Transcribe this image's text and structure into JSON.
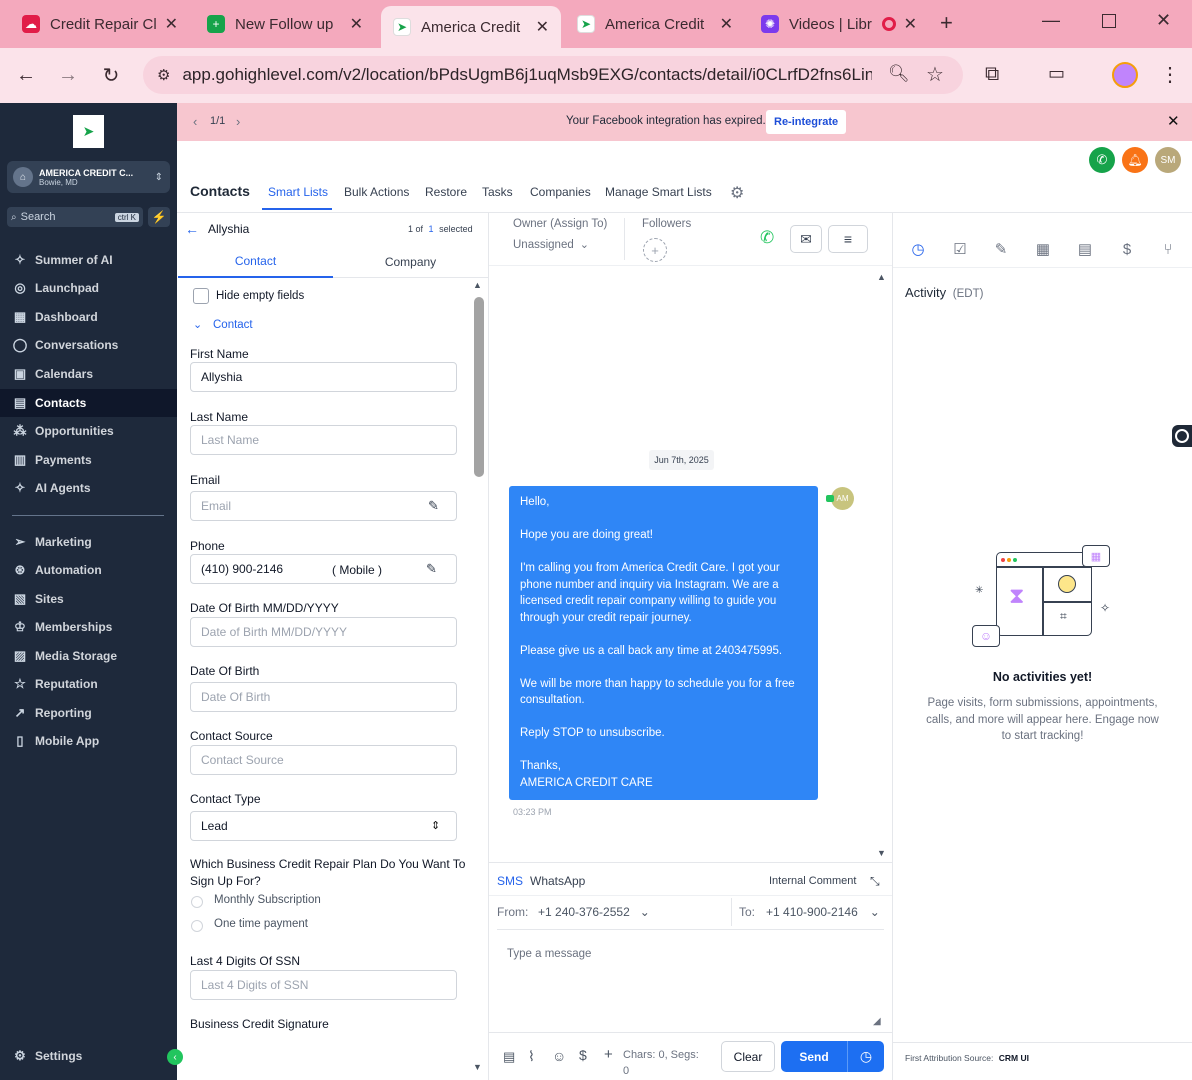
{
  "browser": {
    "tabs": [
      {
        "title": "Credit Repair Cl",
        "favicon_color": "#e11d48"
      },
      {
        "title": "New Follow up",
        "favicon_color": "#16a34a"
      },
      {
        "title": "America Credit",
        "favicon_color": "#ffffff"
      },
      {
        "title": "America Credit",
        "favicon_color": "#ffffff"
      },
      {
        "title": "Videos | Libr",
        "favicon_color": "#7c3aed"
      }
    ],
    "url": "app.gohighlevel.com/v2/location/bPdsUgmB6j1uqMsb9EXG/contacts/detail/i0CLrfD2fns6Lin..."
  },
  "sidebar": {
    "account_name": "AMERICA CREDIT C...",
    "account_location": "Bowie, MD",
    "search_placeholder": "Search",
    "search_shortcut": "ctrl K",
    "items": [
      {
        "label": "Summer of AI",
        "icon": "sparkle-icon"
      },
      {
        "label": "Launchpad",
        "icon": "rocket-icon"
      },
      {
        "label": "Dashboard",
        "icon": "grid-icon"
      },
      {
        "label": "Conversations",
        "icon": "chat-icon"
      },
      {
        "label": "Calendars",
        "icon": "calendar-icon"
      },
      {
        "label": "Contacts",
        "icon": "contacts-icon"
      },
      {
        "label": "Opportunities",
        "icon": "opportunities-icon"
      },
      {
        "label": "Payments",
        "icon": "payments-icon"
      },
      {
        "label": "AI Agents",
        "icon": "ai-agents-icon"
      }
    ],
    "items2": [
      {
        "label": "Marketing",
        "icon": "send-icon"
      },
      {
        "label": "Automation",
        "icon": "automation-icon"
      },
      {
        "label": "Sites",
        "icon": "sites-icon"
      },
      {
        "label": "Memberships",
        "icon": "memberships-icon"
      },
      {
        "label": "Media Storage",
        "icon": "media-icon"
      },
      {
        "label": "Reputation",
        "icon": "star-icon"
      },
      {
        "label": "Reporting",
        "icon": "trend-icon"
      },
      {
        "label": "Mobile App",
        "icon": "mobile-icon"
      }
    ],
    "settings_label": "Settings"
  },
  "banner": {
    "pager": "1/1",
    "message": "Your Facebook integration has expired.",
    "action": "Re-integrate"
  },
  "header": {
    "avatar_initials": "SM",
    "title": "Contacts",
    "tabs": [
      "Smart Lists",
      "Bulk Actions",
      "Restore",
      "Tasks",
      "Companies",
      "Manage Smart Lists"
    ]
  },
  "contact_panel": {
    "name": "Allyshia",
    "count_prefix": "1 of",
    "count_num": "1",
    "count_suffix": "selected",
    "tabs": [
      "Contact",
      "Company"
    ],
    "hide_empty": "Hide empty fields",
    "section": "Contact",
    "fields": {
      "first_name_label": "First Name",
      "first_name_value": "Allyshia",
      "last_name_label": "Last Name",
      "last_name_placeholder": "Last Name",
      "email_label": "Email",
      "email_placeholder": "Email",
      "phone_label": "Phone",
      "phone_value": "(410) 900-2146",
      "phone_type": "( Mobile )",
      "dob1_label": "Date Of Birth MM/DD/YYYY",
      "dob1_placeholder": "Date of Birth MM/DD/YYYY",
      "dob2_label": "Date Of Birth",
      "dob2_placeholder": "Date Of Birth",
      "source_label": "Contact Source",
      "source_placeholder": "Contact Source",
      "type_label": "Contact Type",
      "type_value": "Lead",
      "plan_label_1": "Which Business Credit Repair Plan Do You Want To",
      "plan_label_2": "Sign Up For?",
      "plan_options": [
        "Monthly Subscription",
        "One time payment"
      ],
      "ssn_label": "Last 4 Digits Of SSN",
      "ssn_placeholder": "Last 4 Digits of SSN",
      "signature_label": "Business Credit Signature"
    }
  },
  "conversation": {
    "owner_label": "Owner (Assign To)",
    "owner_value": "Unassigned",
    "followers_label": "Followers",
    "date": "Jun 7th, 2025",
    "sender_initials": "AM",
    "message_paragraphs": [
      "Hello,",
      "Hope you are doing great!",
      "I'm calling you from America Credit Care. I got your phone number and inquiry via Instagram. We are a licensed credit repair company willing to guide you through your credit repair journey.",
      "Please give us a call back any time at 2403475995.",
      "We will be more than happy to schedule you for a free consultation.",
      "Reply STOP to unsubscribe."
    ],
    "message_signoff_1": "Thanks,",
    "message_signoff_2": "AMERICA CREDIT CARE",
    "time": "03:23 PM",
    "composer": {
      "channels": [
        "SMS",
        "WhatsApp"
      ],
      "internal_comment": "Internal Comment",
      "from_label": "From:",
      "from_value": "+1 240-376-2552",
      "to_label": "To:",
      "to_value": "+1 410-900-2146",
      "placeholder": "Type a message",
      "chars": "Chars: 0, Segs:",
      "segs": "0",
      "clear": "Clear",
      "send": "Send"
    }
  },
  "activity": {
    "title": "Activity",
    "timezone": "(EDT)",
    "empty_title": "No activities yet!",
    "empty_text_1": "Page visits, form submissions, appointments,",
    "empty_text_2": "calls, and more will appear here. Engage now",
    "empty_text_3": "to start tracking!",
    "attribution_label": "First Attribution Source:",
    "attribution_value": "CRM UI"
  }
}
